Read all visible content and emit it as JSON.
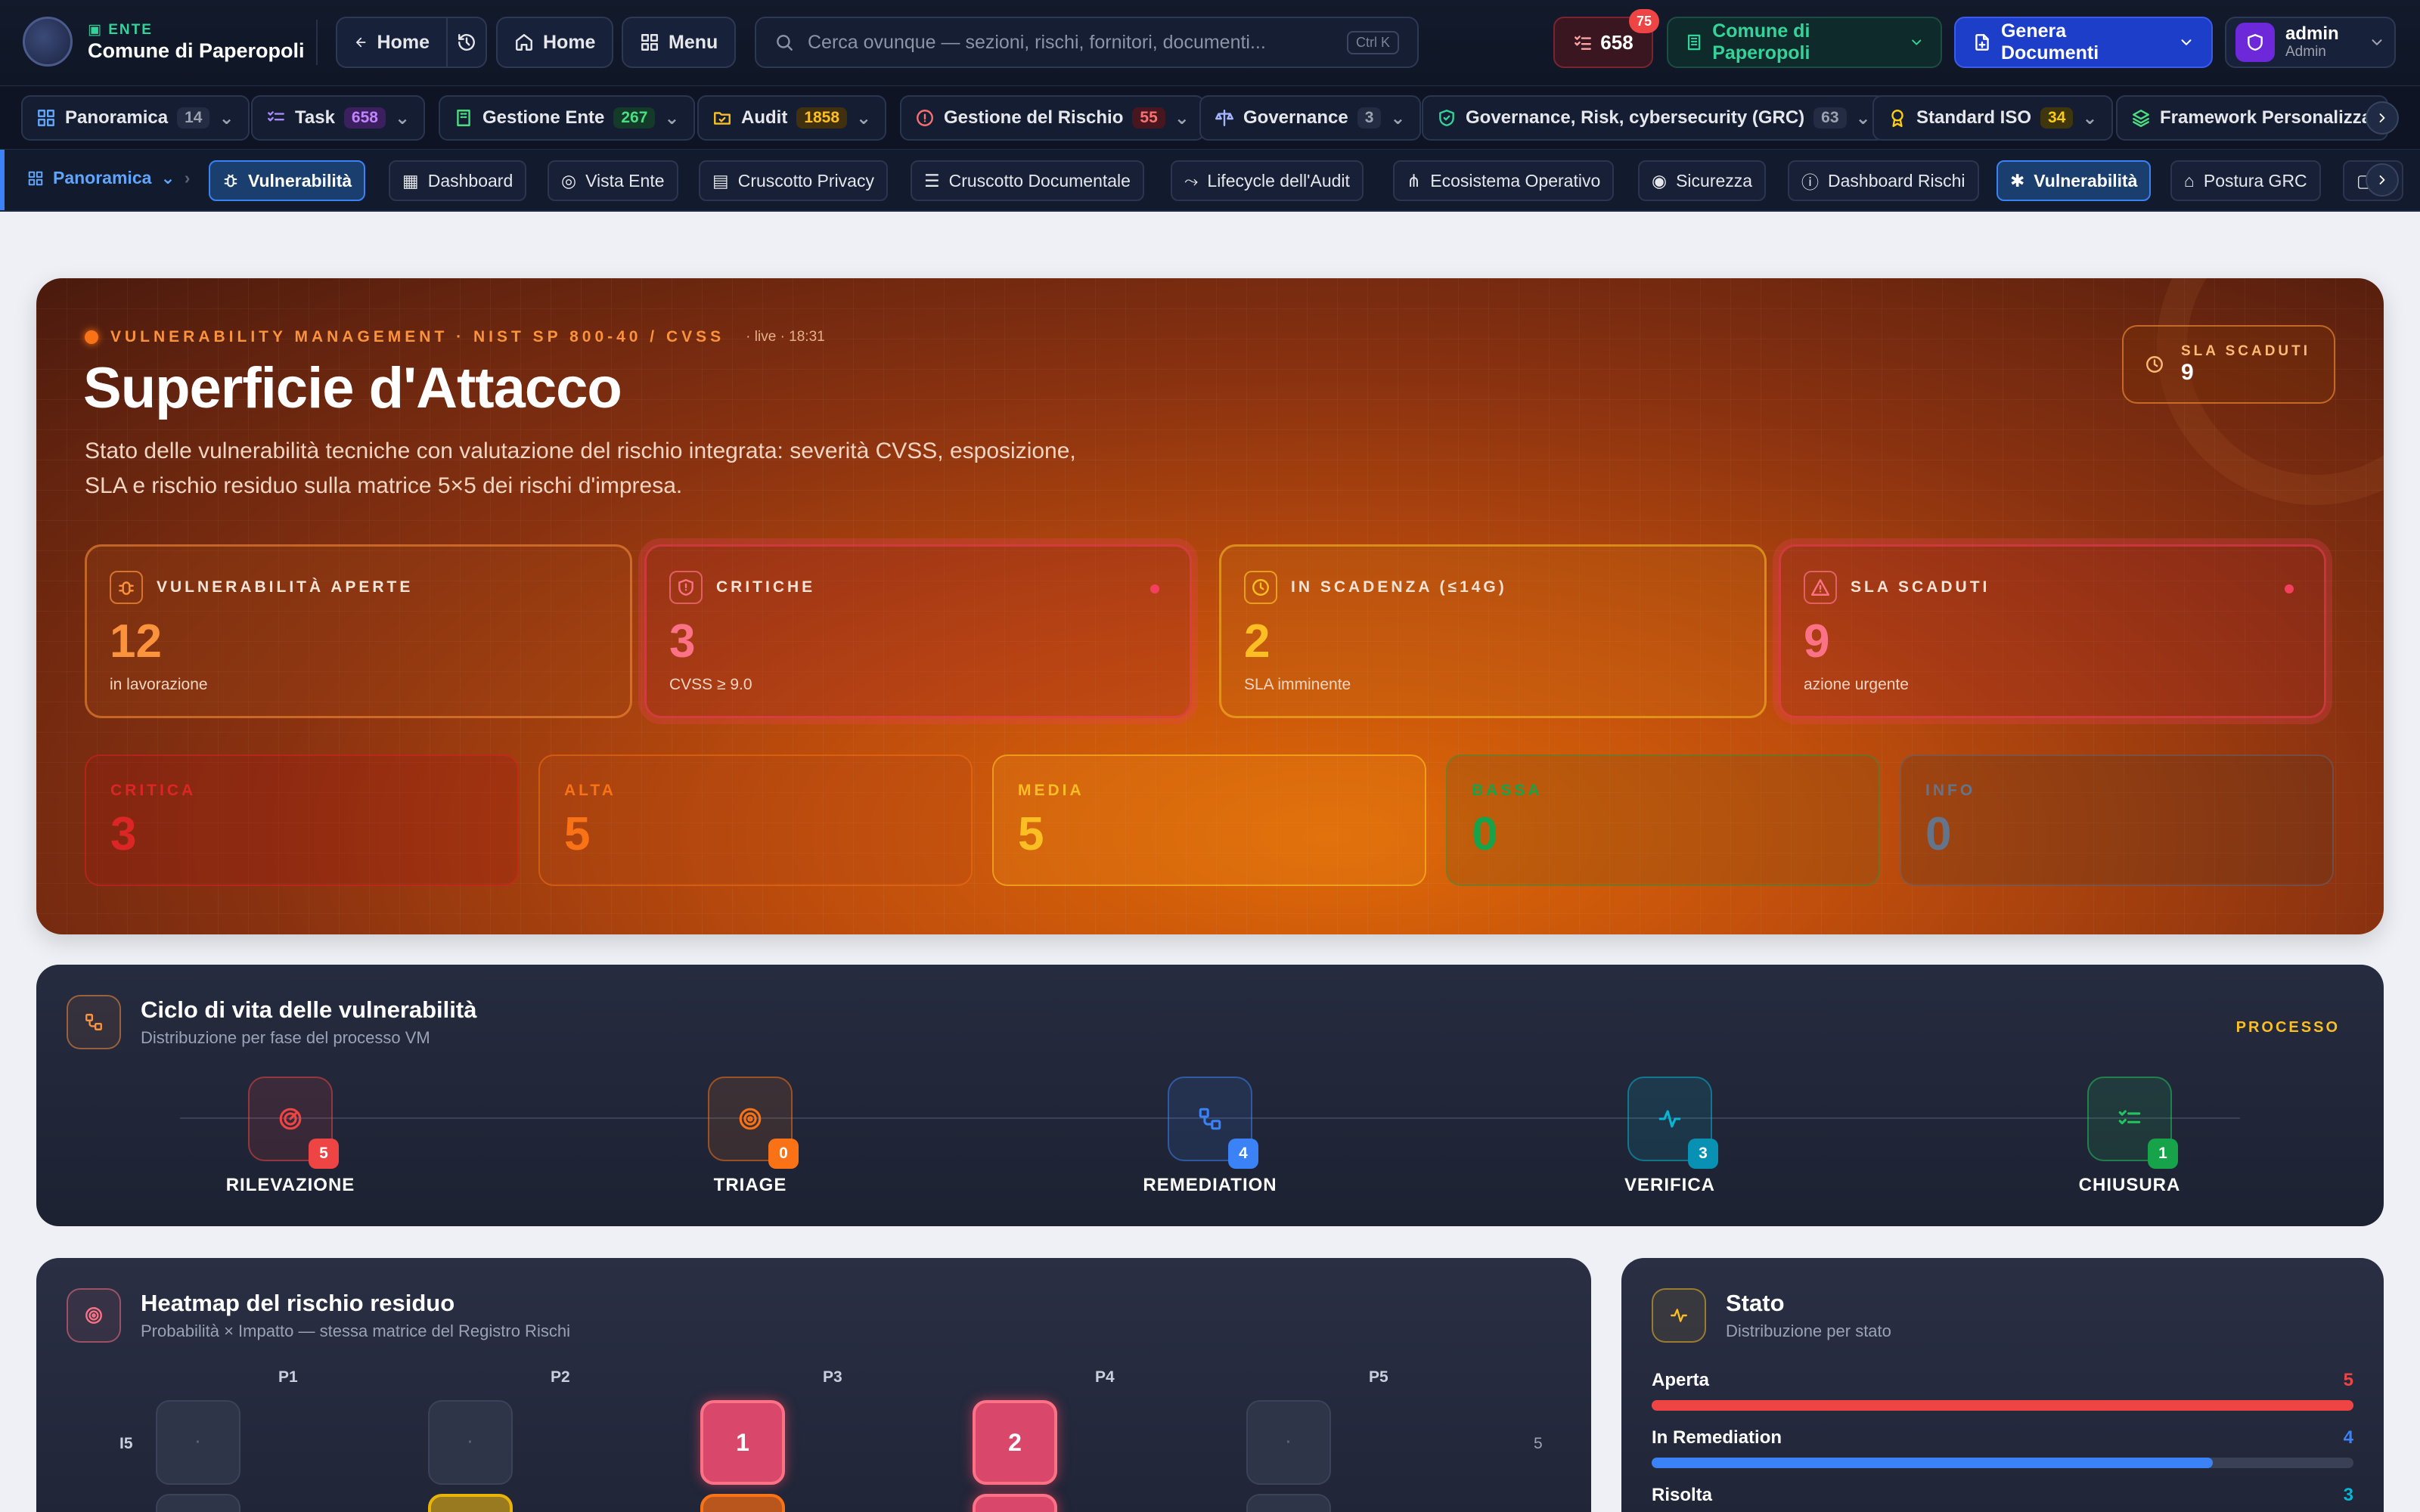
{
  "topbar": {
    "ente_tag": "ENTE",
    "ente_name": "Comune di Paperopoli",
    "back_label": "Home",
    "home_label": "Home",
    "menu_label": "Menu",
    "search_placeholder": "Cerca ovunque — sezioni, rischi, fornitori, documenti...",
    "search_kbd": "Ctrl K",
    "tasks_count": "658",
    "tasks_badge": "75",
    "ente_selector": "Comune di Paperopoli",
    "generate_label": "Genera Documenti",
    "user_name": "admin",
    "user_role": "Admin"
  },
  "modules": [
    {
      "label": "Panoramica",
      "count": "14",
      "icon": "grid-icon",
      "color": "#9ca3af"
    },
    {
      "label": "Task",
      "count": "658",
      "icon": "checklist-icon",
      "color": "#a855f7"
    },
    {
      "label": "Gestione Ente",
      "count": "267",
      "icon": "building-icon",
      "color": "#22c55e"
    },
    {
      "label": "Audit",
      "count": "1858",
      "icon": "folder-check-icon",
      "color": "#f59e0b"
    },
    {
      "label": "Gestione del Rischio",
      "count": "55",
      "icon": "alert-circle-icon",
      "color": "#ef4444"
    },
    {
      "label": "Governance",
      "count": "3",
      "icon": "scale-icon",
      "color": "#9ca3af"
    },
    {
      "label": "Governance, Risk, cybersecurity (GRC)",
      "count": "63",
      "icon": "shield-check-icon",
      "color": "#9ca3af"
    },
    {
      "label": "Standard ISO",
      "count": "34",
      "icon": "award-icon",
      "color": "#eab308"
    },
    {
      "label": "Framework Personalizzati",
      "count": "",
      "icon": "layers-icon",
      "color": "#22c55e"
    }
  ],
  "subbar": {
    "crumb": "Panoramica",
    "current": "Vulnerabilità",
    "tabs": [
      {
        "label": "Dashboard",
        "icon": "grid-icon"
      },
      {
        "label": "Vista Ente",
        "icon": "compass-icon"
      },
      {
        "label": "Cruscotto Privacy",
        "icon": "doc-icon"
      },
      {
        "label": "Cruscotto Documentale",
        "icon": "tree-icon"
      },
      {
        "label": "Lifecycle dell'Audit",
        "icon": "route-icon"
      },
      {
        "label": "Ecosistema Operativo",
        "icon": "network-icon"
      },
      {
        "label": "Sicurezza",
        "icon": "radar-icon"
      },
      {
        "label": "Dashboard Rischi",
        "icon": "alert-circle-icon"
      },
      {
        "label": "Vulnerabilità",
        "icon": "bug-icon"
      },
      {
        "label": "Postura GRC",
        "icon": "landmark-icon"
      }
    ]
  },
  "hero": {
    "eyebrow": "VULNERABILITY MANAGEMENT · NIST SP 800-40 / CVSS",
    "live": "· live · 18:31",
    "title": "Superficie d'Attacco",
    "description": "Stato delle vulnerabilità tecniche con valutazione del rischio integrata: severità CVSS, esposizione, SLA e rischio residuo sulla matrice 5×5 dei rischi d'impresa.",
    "sla_label": "SLA SCADUTI",
    "sla_value": "9",
    "kpis": [
      {
        "label": "VULNERABILITÀ APERTE",
        "value": "12",
        "sub": "in lavorazione",
        "color": "#fb923c"
      },
      {
        "label": "CRITICHE",
        "value": "3",
        "sub": "CVSS ≥ 9.0",
        "color": "#fb7185"
      },
      {
        "label": "IN SCADENZA (≤14G)",
        "value": "2",
        "sub": "SLA imminente",
        "color": "#fbbf24"
      },
      {
        "label": "SLA SCADUTI",
        "value": "9",
        "sub": "azione urgente",
        "color": "#fb7185"
      }
    ],
    "severities": [
      {
        "label": "CRITICA",
        "value": "3",
        "color": "#dc2626"
      },
      {
        "label": "ALTA",
        "value": "5",
        "color": "#f97316"
      },
      {
        "label": "MEDIA",
        "value": "5",
        "color": "#fbbf24"
      },
      {
        "label": "BASSA",
        "value": "0",
        "color": "#16a34a"
      },
      {
        "label": "INFO",
        "value": "0",
        "color": "#64748b"
      }
    ]
  },
  "lifecycle": {
    "title": "Ciclo di vita delle vulnerabilità",
    "subtitle": "Distribuzione per fase del processo VM",
    "tag": "PROCESSO",
    "stages": [
      {
        "label": "RILEVAZIONE",
        "count": "5",
        "color": "#ef4444",
        "icon": "radar-icon"
      },
      {
        "label": "TRIAGE",
        "count": "0",
        "color": "#f97316",
        "icon": "target-icon"
      },
      {
        "label": "REMEDIATION",
        "count": "4",
        "color": "#3b82f6",
        "icon": "workflow-icon"
      },
      {
        "label": "VERIFICA",
        "count": "3",
        "color": "#06b6d4",
        "icon": "pulse-icon"
      },
      {
        "label": "CHIUSURA",
        "count": "1",
        "color": "#22c55e",
        "icon": "list-check-icon"
      }
    ]
  },
  "heatmap": {
    "title": "Heatmap del rischio residuo",
    "subtitle": "Probabilità × Impatto — stessa matrice del Registro Rischi",
    "cols": [
      "P1",
      "P2",
      "P3",
      "P4",
      "P5"
    ],
    "row_label": "I5",
    "row_right": "5",
    "empty": "·",
    "row5": [
      "",
      "",
      "1",
      "2",
      ""
    ]
  },
  "stato": {
    "title": "Stato",
    "subtitle": "Distribuzione per stato",
    "rows": [
      {
        "label": "Aperta",
        "value": "5",
        "fraction": 1.0,
        "color": "#ef4444"
      },
      {
        "label": "In Remediation",
        "value": "4",
        "fraction": 0.8,
        "color": "#3b82f6"
      },
      {
        "label": "Risolta",
        "value": "3",
        "fraction": 0.6,
        "color": "#06b6d4"
      }
    ]
  }
}
